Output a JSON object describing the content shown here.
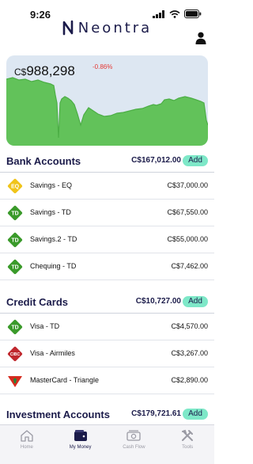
{
  "status": {
    "time": "9:26"
  },
  "brand": {
    "name": "Neontra"
  },
  "summary": {
    "currency": "C$",
    "amount": "988,298",
    "change": "-0.86%"
  },
  "chart_colors": {
    "fill": "#62c25a",
    "line": "#4cae45",
    "background": "#dde7f2"
  },
  "sections": [
    {
      "title": "Bank Accounts",
      "total": "C$167,012.00",
      "add_label": "Add",
      "rows": [
        {
          "icon": "eq-bank-icon",
          "badge": "EQ",
          "color": "#f0c419",
          "name": "Savings - EQ",
          "amount": "C$37,000.00"
        },
        {
          "icon": "td-bank-icon",
          "badge": "TD",
          "color": "#3a9a2a",
          "name": "Savings - TD",
          "amount": "C$67,550.00"
        },
        {
          "icon": "td-bank-icon",
          "badge": "TD",
          "color": "#3a9a2a",
          "name": "Savings.2 - TD",
          "amount": "C$55,000.00"
        },
        {
          "icon": "td-bank-icon",
          "badge": "TD",
          "color": "#3a9a2a",
          "name": "Chequing - TD",
          "amount": "C$7,462.00"
        }
      ]
    },
    {
      "title": "Credit Cards",
      "total": "C$10,727.00",
      "add_label": "Add",
      "rows": [
        {
          "icon": "td-bank-icon",
          "badge": "TD",
          "color": "#3a9a2a",
          "name": "Visa - TD",
          "amount": "C$4,570.00"
        },
        {
          "icon": "cibc-bank-icon",
          "badge": "CIBC",
          "color": "#c0282e",
          "name": "Visa - Airmiles",
          "amount": "C$3,267.00"
        },
        {
          "icon": "canadian-tire-icon",
          "badge": "",
          "color": "#d52b1e",
          "name": "MasterCard - Triangle",
          "amount": "C$2,890.00"
        }
      ]
    },
    {
      "title": "Investment Accounts",
      "total": "C$179,721.61",
      "add_label": "Add",
      "rows": []
    }
  ],
  "tabs": [
    {
      "label": "Home",
      "icon": "home-icon"
    },
    {
      "label": "My Money",
      "icon": "wallet-icon"
    },
    {
      "label": "Cash Flow",
      "icon": "cash-icon"
    },
    {
      "label": "Tools",
      "icon": "tools-icon"
    }
  ]
}
